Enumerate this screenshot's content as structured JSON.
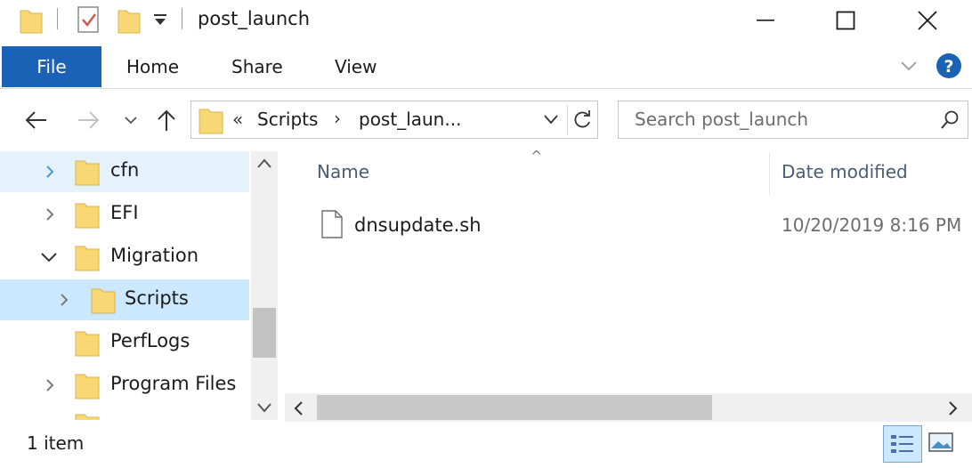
{
  "window": {
    "title": "post_launch",
    "minimize_icon": "minimize-icon",
    "maximize_icon": "maximize-icon",
    "close_icon": "close-icon"
  },
  "ribbon": {
    "tabs": [
      "File",
      "Home",
      "Share",
      "View"
    ],
    "active_tab": "File",
    "accent_color": "#1a62b6"
  },
  "address_bar": {
    "overflow_chevrons": "«",
    "crumbs": [
      "Scripts",
      "post_laun..."
    ],
    "separator": "›"
  },
  "search": {
    "placeholder": "Search post_launch"
  },
  "tree": {
    "items": [
      {
        "label": "cfn",
        "expander": "collapsed",
        "state": "hover"
      },
      {
        "label": "EFI",
        "expander": "collapsed",
        "state": ""
      },
      {
        "label": "Migration",
        "expander": "expanded",
        "state": ""
      },
      {
        "label": "Scripts",
        "expander": "collapsed",
        "state": "selected"
      },
      {
        "label": "PerfLogs",
        "expander": "none",
        "state": ""
      },
      {
        "label": "Program Files",
        "expander": "collapsed",
        "state": ""
      }
    ]
  },
  "file_list": {
    "columns": [
      "Name",
      "Date modified"
    ],
    "sort_indicator": "^",
    "rows": [
      {
        "name": "dnsupdate.sh",
        "date_modified": "10/20/2019 8:16 PM",
        "icon": "document-icon"
      }
    ]
  },
  "status_bar": {
    "item_count": "1 item"
  }
}
